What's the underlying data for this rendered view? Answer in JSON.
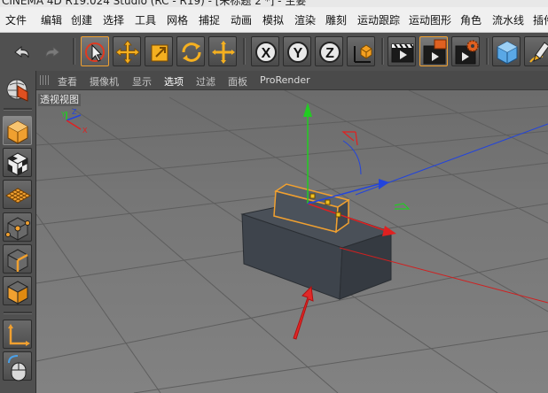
{
  "window": {
    "title": "CINEMA 4D R19.024 Studio (RC - R19) - [未标题 2 *] - 主要"
  },
  "menu": {
    "items": [
      "文件",
      "编辑",
      "创建",
      "选择",
      "工具",
      "网格",
      "捕捉",
      "动画",
      "模拟",
      "渲染",
      "雕刻",
      "运动跟踪",
      "运动图形",
      "角色",
      "流水线",
      "插件"
    ]
  },
  "toolbar": {
    "buttons": [
      {
        "name": "undo-icon"
      },
      {
        "name": "redo-icon"
      },
      {
        "name": "live-selection-icon",
        "state": "active"
      },
      {
        "name": "move-icon"
      },
      {
        "name": "scale-icon"
      },
      {
        "name": "rotate-icon"
      },
      {
        "name": "add-icon"
      },
      {
        "name": "x-axis-lock-icon",
        "label": "X"
      },
      {
        "name": "y-axis-lock-icon",
        "label": "Y"
      },
      {
        "name": "z-axis-lock-icon",
        "label": "Z"
      },
      {
        "name": "coordinate-system-icon"
      },
      {
        "name": "render-view-icon"
      },
      {
        "name": "render-to-picture-viewer-icon",
        "state": "active"
      },
      {
        "name": "render-settings-icon"
      },
      {
        "name": "cube-primitive-icon"
      },
      {
        "name": "pen-spline-icon"
      }
    ]
  },
  "left_tools": {
    "buttons": [
      {
        "name": "make-editable-icon"
      },
      {
        "name": "model-mode-icon",
        "state": "active"
      },
      {
        "name": "texture-mode-icon"
      },
      {
        "name": "workplane-mode-icon"
      },
      {
        "name": "points-mode-icon"
      },
      {
        "name": "edges-mode-icon"
      },
      {
        "name": "polygons-mode-icon"
      },
      {
        "name": "enable-axis-icon"
      },
      {
        "name": "tweak-mode-icon"
      }
    ]
  },
  "viewport": {
    "menu": {
      "items": [
        "查看",
        "摄像机",
        "显示",
        "选项",
        "过滤",
        "面板",
        "ProRender"
      ],
      "selected": "选项"
    },
    "label": "透视视图",
    "axis_labels": {
      "y": "Y",
      "z": "Z",
      "x": "X"
    }
  },
  "colors": {
    "accent": "#f0a030",
    "axis_x": "#e02020",
    "axis_y": "#22cc22",
    "axis_z": "#2255ee",
    "annotation_arrow": "#e02828"
  }
}
